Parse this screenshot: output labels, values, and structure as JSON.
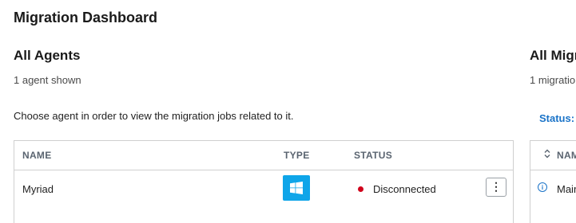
{
  "page": {
    "title": "Migration Dashboard"
  },
  "agents": {
    "title": "All Agents",
    "count_text": "1 agent shown",
    "hint": "Choose agent in order to view the migration jobs related to it.",
    "columns": {
      "name": "NAME",
      "type": "TYPE",
      "status": "STATUS"
    },
    "rows": [
      {
        "name": "Myriad",
        "type_icon": "windows-icon",
        "status": "Disconnected",
        "status_color": "#d0021b"
      }
    ]
  },
  "migrations": {
    "title": "All Migr",
    "count_text": "1 migratio",
    "status_filter_label": "Status:",
    "columns": {
      "name": "NAM"
    },
    "rows": [
      {
        "name": "Mair",
        "icon": "info-icon"
      }
    ]
  },
  "colors": {
    "accent": "#1a73c8",
    "windows_badge": "#0ea5e9",
    "status_disconnected": "#d0021b"
  }
}
